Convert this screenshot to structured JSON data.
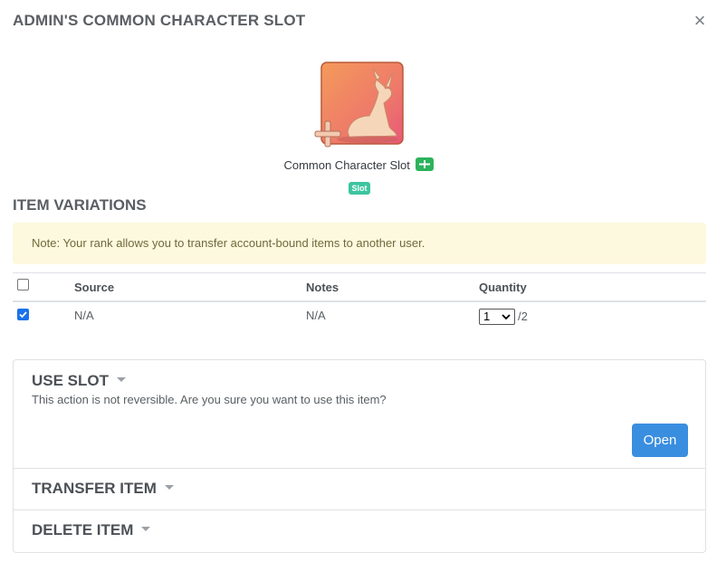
{
  "modal": {
    "title": "ADMIN'S COMMON CHARACTER SLOT",
    "close_label": "×"
  },
  "item": {
    "name": "Common Character Slot",
    "badge": "Slot",
    "icon": "fawn-slot-icon",
    "colors": {
      "plus_badge": "#2cb35c",
      "slot_badge": "#3cc5a0"
    }
  },
  "variations": {
    "heading": "ITEM VARIATIONS",
    "note": "Note: Your rank allows you to transfer account-bound items to another user.",
    "columns": [
      "Source",
      "Notes",
      "Quantity"
    ],
    "rows": [
      {
        "checked": true,
        "source": "N/A",
        "notes": "N/A",
        "quantity": "1",
        "total": "/2"
      }
    ]
  },
  "actions": {
    "use": {
      "title": "USE SLOT",
      "description": "This action is not reversible. Are you sure you want to use this item?",
      "button": "Open"
    },
    "transfer": {
      "title": "TRANSFER ITEM"
    },
    "delete": {
      "title": "DELETE ITEM"
    }
  },
  "colors": {
    "accent": "#3a8ee0",
    "note_bg": "#fdf9de"
  }
}
